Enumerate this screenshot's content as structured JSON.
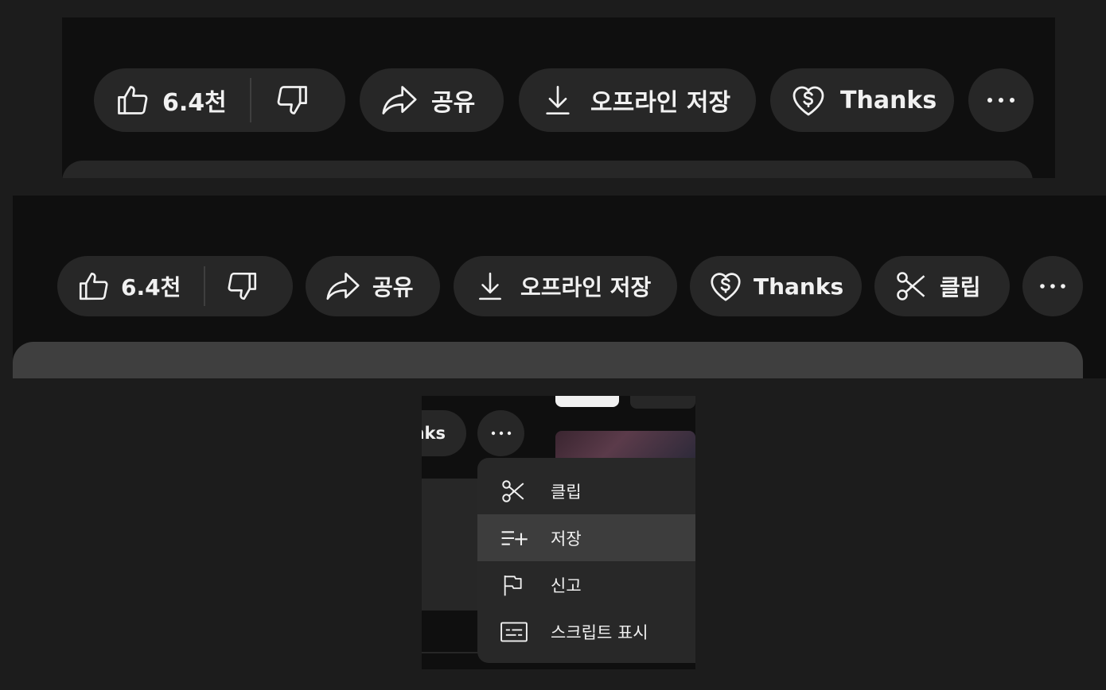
{
  "actions": {
    "like_count": "6.4천",
    "share_label": "공유",
    "download_label": "오프라인 저장",
    "thanks_label": "Thanks",
    "clip_label": "클립"
  },
  "crop": {
    "thanks_partial": "nks"
  },
  "menu": {
    "items": [
      {
        "label": "클립",
        "icon": "scissors-icon"
      },
      {
        "label": "저장",
        "icon": "playlist-add-icon"
      },
      {
        "label": "신고",
        "icon": "flag-icon"
      },
      {
        "label": "스크립트 표시",
        "icon": "transcript-icon"
      }
    ],
    "highlighted_index": 1
  },
  "colors": {
    "page_bg": "#1c1c1c",
    "panel_bg": "#0f0f0f",
    "button_bg": "#272727",
    "menu_bg": "#282828",
    "menu_highlight": "#3d3d3d",
    "text": "#f1f1f1"
  }
}
